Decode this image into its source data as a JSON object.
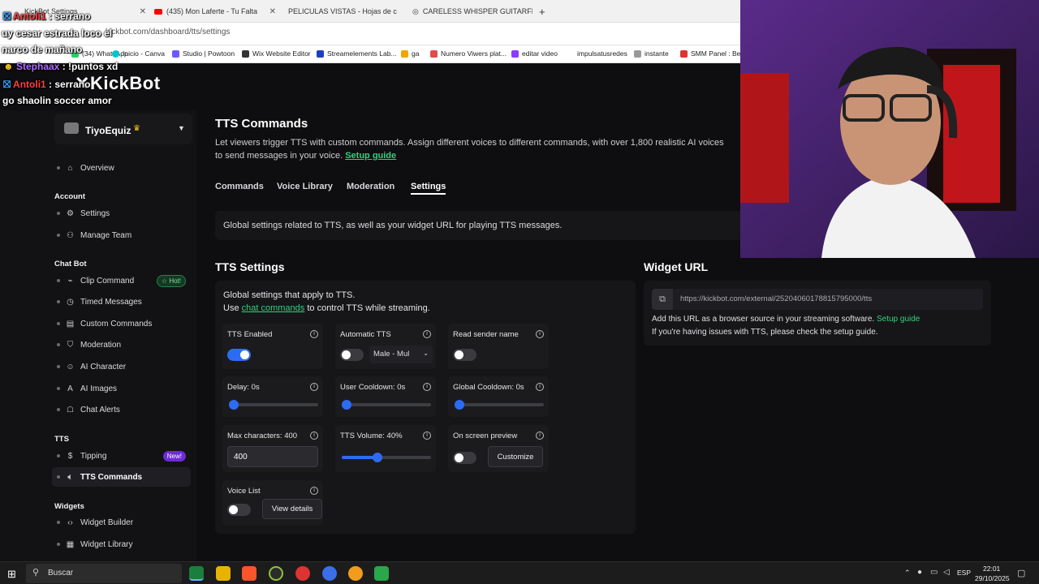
{
  "browser": {
    "tabs": [
      {
        "label": "KickBot Settings",
        "active": true
      },
      {
        "label": "(435) Mon Laferte - Tu Falta",
        "icon": "youtube-icon"
      },
      {
        "label": "PELICULAS VISTAS - Hojas de c",
        "icon": "sheets-icon"
      },
      {
        "label": "CARELESS WHISPER GUITARFL",
        "icon": "globe-icon"
      }
    ],
    "url": "kickbot.com/dashboard/tts/settings",
    "bookmarks": [
      "(34) WhatsApp",
      "Inicio - Canva",
      "Studio | Powtoon",
      "Wix Website Editor",
      "Streamelements Lab...",
      "ga",
      "Numero Viwers plat...",
      "editar video",
      "impulsatusredes",
      "instante",
      "SMM Panel : Best"
    ]
  },
  "chat_overlay": [
    {
      "user": "Antoli1",
      "text": ": serrano",
      "color": "#ff4040"
    },
    {
      "user": "",
      "text": "uy cesar estrada loco el",
      "color": "#ffffff"
    },
    {
      "user": "",
      "text": "narco de mañano",
      "color": "#ffffff"
    },
    {
      "user": "Stephaax",
      "text": ": !puntos xd",
      "color": "#b26bff"
    },
    {
      "user": "Antoli1",
      "text": ": serrano",
      "color": "#ff4040"
    },
    {
      "user": "",
      "text": "go shaolin soccer amor",
      "color": "#ffffff"
    }
  ],
  "app": {
    "logo": "KickBot",
    "account_name": "TiyoEquiz",
    "sidebar": {
      "overview": "Overview",
      "sections": [
        {
          "title": "Account",
          "items": [
            {
              "label": "Settings",
              "icon": "gear-icon"
            },
            {
              "label": "Manage Team",
              "icon": "team-icon"
            }
          ]
        },
        {
          "title": "Chat Bot",
          "items": [
            {
              "label": "Clip Command",
              "icon": "clip-icon",
              "badge": "Hot!"
            },
            {
              "label": "Timed Messages",
              "icon": "clock-icon"
            },
            {
              "label": "Custom Commands",
              "icon": "code-icon"
            },
            {
              "label": "Moderation",
              "icon": "shield-icon"
            },
            {
              "label": "AI Character",
              "icon": "ai-icon"
            },
            {
              "label": "AI Images",
              "icon": "image-icon"
            },
            {
              "label": "Chat Alerts",
              "icon": "chat-icon"
            }
          ]
        },
        {
          "title": "TTS",
          "items": [
            {
              "label": "Tipping",
              "icon": "dollar-icon",
              "badge": "New!"
            },
            {
              "label": "TTS Commands",
              "icon": "speaker-icon",
              "active": true
            }
          ]
        },
        {
          "title": "Widgets",
          "items": [
            {
              "label": "Widget Builder",
              "icon": "code-icon"
            },
            {
              "label": "Widget Library",
              "icon": "grid-icon"
            }
          ]
        }
      ]
    },
    "page": {
      "title": "TTS Commands",
      "description": "Let viewers trigger TTS with custom commands. Assign different voices to different commands, with over 1,800 realistic AI voices",
      "description2": "to send messages in your voice.",
      "setup_guide": "Setup guide",
      "tabs": [
        "Commands",
        "Voice Library",
        "Moderation",
        "Settings"
      ],
      "active_tab": "Settings",
      "info_banner": "Global settings related to TTS, as well as your widget URL for playing TTS messages."
    },
    "tts_settings": {
      "heading": "TTS Settings",
      "intro1": "Global settings that apply to TTS.",
      "intro2_pre": "Use",
      "intro2_link": "chat commands",
      "intro2_post": "to control TTS while streaming.",
      "tts_enabled": {
        "label": "TTS Enabled",
        "on": true
      },
      "automatic_tts": {
        "label": "Automatic TTS",
        "on": false,
        "voice": "Male - Mul"
      },
      "read_sender": {
        "label": "Read sender name",
        "on": false
      },
      "delay": {
        "label": "Delay: 0s",
        "value": 0
      },
      "user_cooldown": {
        "label": "User Cooldown: 0s",
        "value": 0
      },
      "global_cooldown": {
        "label": "Global Cooldown: 0s",
        "value": 0
      },
      "max_chars": {
        "label": "Max characters: 400",
        "value": "400"
      },
      "volume": {
        "label": "TTS Volume: 40%",
        "value": 0.4
      },
      "preview": {
        "label": "On screen preview",
        "on": false,
        "button": "Customize"
      },
      "voice_list": {
        "label": "Voice List",
        "on": false,
        "button": "View details"
      }
    },
    "widget": {
      "heading": "Widget URL",
      "url": "https://kickbot.com/external/25204060178815795000/tts",
      "hint_pre": "Add this URL as a browser source in your streaming software.",
      "hint_link": "Setup guide",
      "hint2": "If you're having issues with TTS, please check the setup guide."
    }
  },
  "taskbar": {
    "search": "Buscar",
    "lang": "ESP",
    "time": "22:01",
    "date": "29/10/2025"
  }
}
